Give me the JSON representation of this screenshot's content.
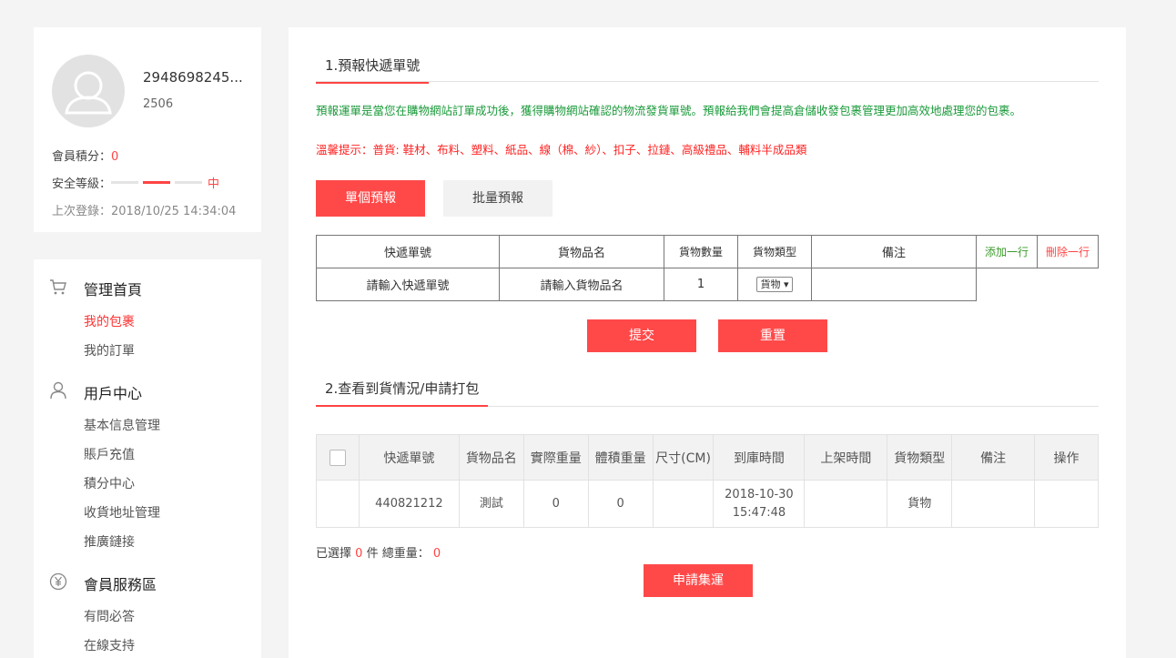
{
  "profile": {
    "username": "2948698245...",
    "user_id": "2506",
    "points_label": "會員積分：",
    "points_value": "0",
    "security_label": "安全等級：",
    "security_level": "中",
    "last_login": "上次登錄：2018/10/25 14:34:04"
  },
  "menu": {
    "sections": [
      {
        "title": "管理首頁",
        "icon": "cart-icon",
        "items": [
          "我的包裹",
          "我的訂單"
        ]
      },
      {
        "title": "用戶中心",
        "icon": "user-icon",
        "items": [
          "基本信息管理",
          "賬戶充值",
          "積分中心",
          "收貨地址管理",
          "推廣鏈接"
        ]
      },
      {
        "title": "會員服務區",
        "icon": "yen-icon",
        "items": [
          "有問必答",
          "在線支持"
        ]
      }
    ],
    "active_item": "我的包裹"
  },
  "section1": {
    "title": "1.預報快遞單號",
    "note_green": "預報運單是當您在購物網站訂單成功後，獲得購物網站確認的物流發貨單號。預報給我們會提高倉儲收發包裹管理更加高效地處理您的包裹。",
    "note_red": "溫馨提示：普貨: 鞋材、布料、塑料、紙品、線（棉、紗）、扣子、拉鏈、高級禮品、輔料半成品類",
    "tab_single": "單個預報",
    "tab_batch": "批量預報",
    "headers": [
      "快遞單號",
      "貨物品名",
      "貨物數量",
      "貨物類型",
      "備注"
    ],
    "add_row": "添加一行",
    "delete_row": "刪除一行",
    "row": {
      "tracking_placeholder": "請輸入快遞單號",
      "goods_placeholder": "請輸入貨物品名",
      "quantity": "1",
      "type_selected": "貨物"
    },
    "submit": "提交",
    "reset": "重置"
  },
  "section2": {
    "title": "2.查看到貨情況/申請打包",
    "headers": [
      "快遞單號",
      "貨物品名",
      "實際重量",
      "體積重量",
      "尺寸(CM)",
      "到庫時間",
      "上架時間",
      "貨物類型",
      "備注",
      "操作"
    ],
    "rows": [
      {
        "tracking": "440821212",
        "goods": "測試",
        "actual_weight": "0",
        "volume_weight": "0",
        "size": "",
        "arrival_date": "2018-10-30",
        "arrival_time": "15:47:48",
        "shelf_time": "",
        "type": "貨物",
        "remark": "",
        "action": ""
      }
    ],
    "selected_label": "已選擇",
    "selected_count": "0",
    "unit_label": "件 總重量：",
    "total_weight": "0",
    "apply_button": "申請集運"
  },
  "colors": {
    "accent": "#ff4949",
    "green": "#1a9a3a"
  }
}
